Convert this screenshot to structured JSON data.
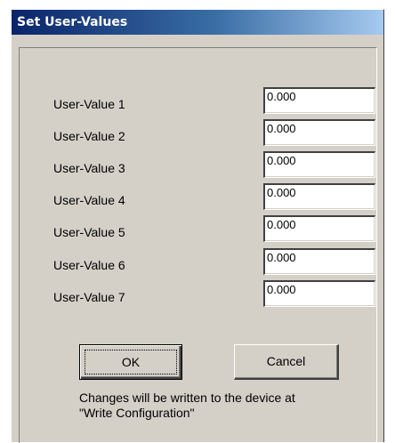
{
  "window": {
    "title": "Set User-Values"
  },
  "fields": [
    {
      "label": "User-Value 1",
      "value": "0.000"
    },
    {
      "label": "User-Value 2",
      "value": "0.000"
    },
    {
      "label": "User-Value 3",
      "value": "0.000"
    },
    {
      "label": "User-Value 4",
      "value": "0.000"
    },
    {
      "label": "User-Value 5",
      "value": "0.000"
    },
    {
      "label": "User-Value 6",
      "value": "0.000"
    },
    {
      "label": "User-Value 7",
      "value": "0.000"
    }
  ],
  "buttons": {
    "ok_label": "OK",
    "cancel_label": "Cancel"
  },
  "note": {
    "line1": "Changes will be written to the device at",
    "line2": "\"Write Configuration\""
  }
}
